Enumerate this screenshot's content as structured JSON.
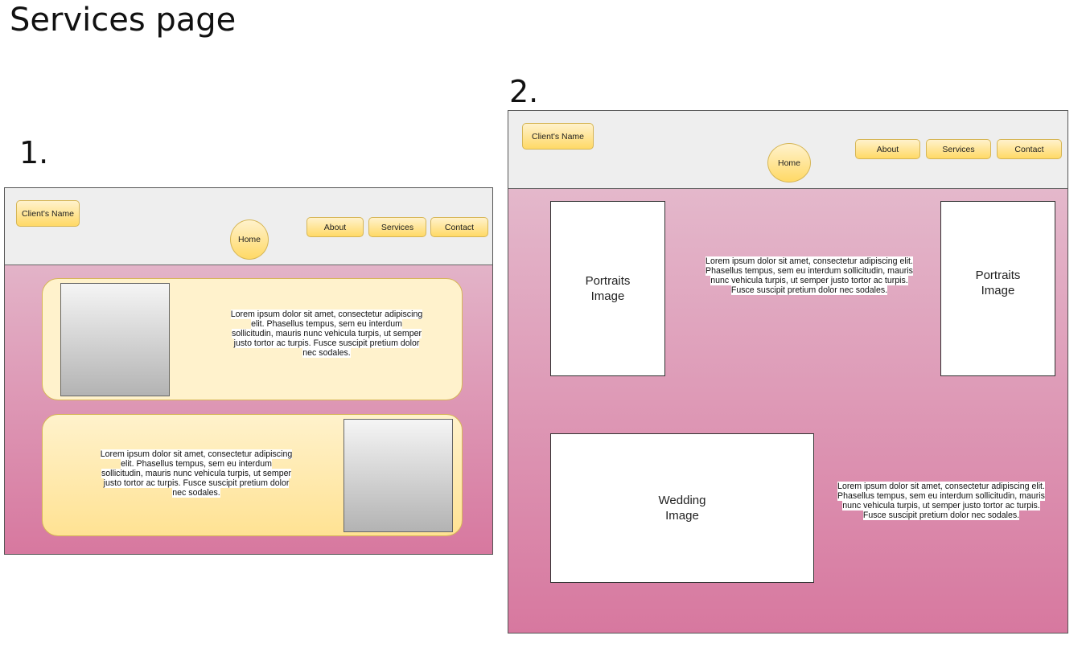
{
  "title": "Services page",
  "mockups": [
    {
      "number": "1.",
      "client_name": "Client's Name",
      "nav": {
        "home": "Home",
        "about": "About",
        "services": "Services",
        "contact": "Contact"
      },
      "text_1": "Lorem ipsum dolor sit amet, consectetur adipiscing elit. Phasellus tempus, sem eu interdum sollicitudin, mauris nunc vehicula turpis, ut semper justo tortor ac turpis. Fusce suscipit pretium dolor nec sodales.",
      "text_2": "Lorem ipsum dolor sit amet, consectetur adipiscing elit. Phasellus tempus, sem eu interdum sollicitudin, mauris nunc vehicula turpis, ut semper justo tortor ac turpis. Fusce suscipit pretium dolor nec sodales."
    },
    {
      "number": "2.",
      "client_name": "Client's Name",
      "nav": {
        "home": "Home",
        "about": "About",
        "services": "Services",
        "contact": "Contact"
      },
      "portraits_left": "Portraits\nImage",
      "portraits_right": "Portraits\nImage",
      "wedding": "Wedding\nImage",
      "text_1": "Lorem ipsum dolor sit amet, consectetur adipiscing elit. Phasellus tempus, sem eu interdum sollicitudin, mauris nunc vehicula turpis, ut semper justo tortor ac turpis. Fusce suscipit pretium dolor nec sodales.",
      "text_2": "Lorem ipsum dolor sit amet, consectetur adipiscing elit. Phasellus tempus, sem eu interdum sollicitudin, mauris nunc vehicula turpis, ut semper justo tortor ac turpis. Fusce suscipit pretium dolor nec sodales."
    }
  ]
}
